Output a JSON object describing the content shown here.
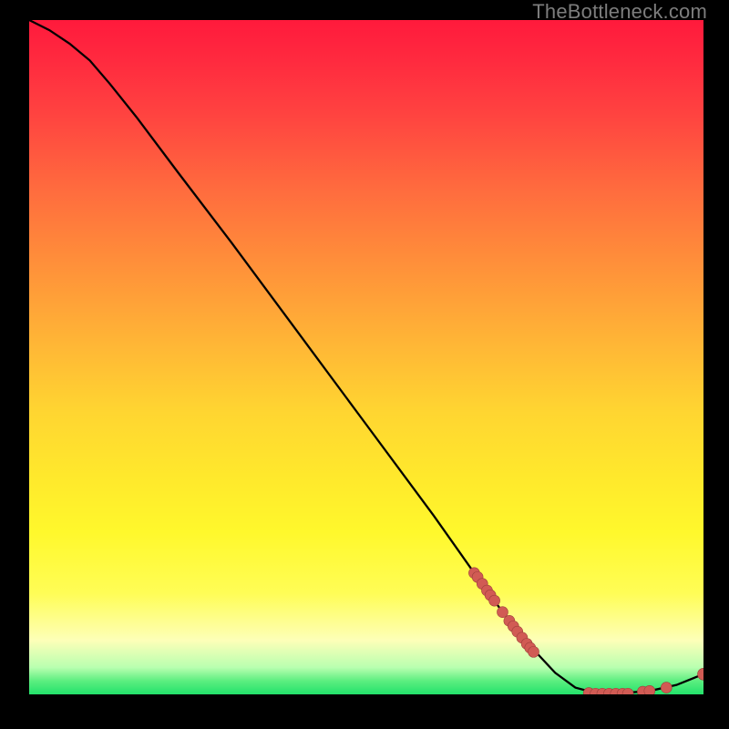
{
  "watermark": "TheBottleneck.com",
  "colors": {
    "curve": "#000000",
    "marker_fill": "#d15b54",
    "marker_stroke": "#9e3f3a",
    "bg_black": "#000000"
  },
  "chart_data": {
    "type": "line",
    "title": "",
    "xlabel": "",
    "ylabel": "",
    "xlim": [
      0,
      100
    ],
    "ylim": [
      0,
      100
    ],
    "grid": false,
    "annotations": [
      "TheBottleneck.com"
    ],
    "curve": [
      {
        "x": 0,
        "y": 100
      },
      {
        "x": 3,
        "y": 98.5
      },
      {
        "x": 6,
        "y": 96.5
      },
      {
        "x": 9,
        "y": 94
      },
      {
        "x": 12,
        "y": 90.5
      },
      {
        "x": 16,
        "y": 85.5
      },
      {
        "x": 22,
        "y": 77.5
      },
      {
        "x": 30,
        "y": 67
      },
      {
        "x": 40,
        "y": 53.5
      },
      {
        "x": 50,
        "y": 40
      },
      {
        "x": 60,
        "y": 26.5
      },
      {
        "x": 66,
        "y": 18
      },
      {
        "x": 70,
        "y": 12.5
      },
      {
        "x": 74,
        "y": 7.5
      },
      {
        "x": 78,
        "y": 3.2
      },
      {
        "x": 81,
        "y": 1
      },
      {
        "x": 84,
        "y": 0.2
      },
      {
        "x": 88,
        "y": 0.2
      },
      {
        "x": 92,
        "y": 0.5
      },
      {
        "x": 96,
        "y": 1.4
      },
      {
        "x": 100,
        "y": 3
      }
    ],
    "markers": [
      {
        "x": 66,
        "y": 18
      },
      {
        "x": 66.5,
        "y": 17.4
      },
      {
        "x": 67.2,
        "y": 16.4
      },
      {
        "x": 67.9,
        "y": 15.4
      },
      {
        "x": 68.4,
        "y": 14.7
      },
      {
        "x": 69,
        "y": 13.9
      },
      {
        "x": 70.2,
        "y": 12.2
      },
      {
        "x": 71.2,
        "y": 10.9
      },
      {
        "x": 71.8,
        "y": 10.1
      },
      {
        "x": 72.4,
        "y": 9.3
      },
      {
        "x": 73.1,
        "y": 8.4
      },
      {
        "x": 73.8,
        "y": 7.5
      },
      {
        "x": 74.3,
        "y": 6.9
      },
      {
        "x": 74.8,
        "y": 6.3
      },
      {
        "x": 83,
        "y": 0.2
      },
      {
        "x": 84,
        "y": 0.1
      },
      {
        "x": 85,
        "y": 0.1
      },
      {
        "x": 86,
        "y": 0.1
      },
      {
        "x": 87,
        "y": 0.1
      },
      {
        "x": 88,
        "y": 0.1
      },
      {
        "x": 88.8,
        "y": 0.1
      },
      {
        "x": 91,
        "y": 0.4
      },
      {
        "x": 92,
        "y": 0.5
      },
      {
        "x": 94.5,
        "y": 1.0
      },
      {
        "x": 100,
        "y": 3
      }
    ]
  }
}
